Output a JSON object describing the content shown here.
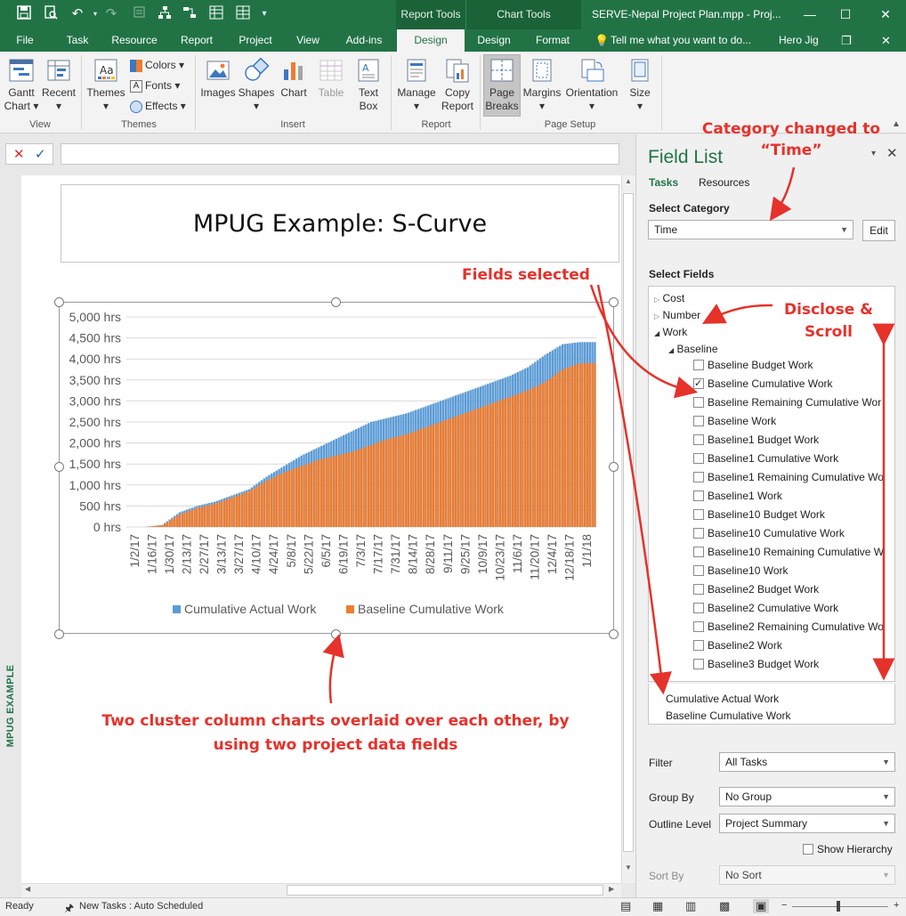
{
  "window": {
    "title": "SERVE-Nepal Project Plan.mpp - Proj...",
    "context_tabs": [
      "Report Tools",
      "Chart Tools"
    ],
    "user": "Hero Jig",
    "tell_me": "Tell me what you want to do..."
  },
  "tabs": [
    "File",
    "Task",
    "Resource",
    "Report",
    "Project",
    "View",
    "Add-ins",
    "Design",
    "Design",
    "Format"
  ],
  "ribbon": {
    "view": {
      "gantt_chart": "Gantt",
      "gantt_chart2": "Chart",
      "recent": "Recent",
      "label": "View"
    },
    "themes": {
      "themes": "Themes",
      "colors": "Colors",
      "fonts": "Fonts",
      "effects": "Effects",
      "label": "Themes"
    },
    "insert": {
      "images": "Images",
      "shapes": "Shapes",
      "chart": "Chart",
      "table": "Table",
      "textbox1": "Text",
      "textbox2": "Box",
      "label": "Insert"
    },
    "report": {
      "manage": "Manage",
      "copy1": "Copy",
      "copy2": "Report",
      "label": "Report"
    },
    "page_setup": {
      "page1": "Page",
      "page2": "Breaks",
      "margins": "Margins",
      "orientation": "Orientation",
      "size": "Size",
      "label": "Page Setup"
    }
  },
  "report": {
    "title": "MPUG Example: S-Curve",
    "side_label": "MPUG EXAMPLE"
  },
  "chart_data": {
    "type": "bar",
    "title": "",
    "xlabel": "",
    "ylabel": "",
    "ylim": [
      0,
      5000
    ],
    "y_ticks": [
      "5,000 hrs",
      "4,500 hrs",
      "4,000 hrs",
      "3,500 hrs",
      "3,000 hrs",
      "2,500 hrs",
      "2,000 hrs",
      "1,500 hrs",
      "1,000 hrs",
      "500 hrs",
      "0 hrs"
    ],
    "x_ticks": [
      "1/2/17",
      "1/16/17",
      "1/30/17",
      "2/13/17",
      "2/27/17",
      "3/13/17",
      "3/27/17",
      "4/10/17",
      "4/24/17",
      "5/8/17",
      "5/22/17",
      "6/5/17",
      "6/19/17",
      "7/3/17",
      "7/17/17",
      "7/31/17",
      "8/14/17",
      "8/28/17",
      "9/11/17",
      "9/25/17",
      "10/9/17",
      "10/23/17",
      "11/6/17",
      "11/20/17",
      "12/4/17",
      "12/18/17",
      "1/1/18"
    ],
    "series": [
      {
        "name": "Cumulative Actual Work",
        "color": "#5b9bd5",
        "values": [
          0,
          0,
          50,
          350,
          500,
          600,
          750,
          900,
          1200,
          1450,
          1700,
          1900,
          2100,
          2300,
          2500,
          2600,
          2700,
          2850,
          3000,
          3150,
          3300,
          3450,
          3600,
          3800,
          4100,
          4350,
          4400
        ]
      },
      {
        "name": "Baseline Cumulative Work",
        "color": "#ed7d31",
        "values": [
          0,
          0,
          40,
          300,
          450,
          550,
          700,
          850,
          1100,
          1300,
          1450,
          1600,
          1700,
          1800,
          1950,
          2100,
          2200,
          2350,
          2500,
          2650,
          2800,
          2950,
          3100,
          3250,
          3450,
          3750,
          3900
        ]
      }
    ],
    "legend": "bottom"
  },
  "annotations": {
    "category": [
      "Category changed to",
      "“Time”"
    ],
    "fields": "Fields selected",
    "disclose": [
      "Disclose &",
      "Scroll"
    ],
    "overlay": [
      "Two cluster column charts overlaid over each other, by",
      "using two project data fields"
    ]
  },
  "field_list": {
    "title": "Field List",
    "tabs": [
      "Tasks",
      "Resources"
    ],
    "select_category_label": "Select Category",
    "category_value": "Time",
    "edit_label": "Edit",
    "select_fields_label": "Select Fields",
    "tree_groups": [
      "Cost",
      "Number",
      "Work",
      "Baseline"
    ],
    "fields": [
      {
        "name": "Baseline Budget Work",
        "checked": false
      },
      {
        "name": "Baseline Cumulative Work",
        "checked": true
      },
      {
        "name": "Baseline Remaining Cumulative Wor",
        "checked": false
      },
      {
        "name": "Baseline Work",
        "checked": false
      },
      {
        "name": "Baseline1 Budget Work",
        "checked": false
      },
      {
        "name": "Baseline1 Cumulative Work",
        "checked": false
      },
      {
        "name": "Baseline1 Remaining Cumulative Wo",
        "checked": false
      },
      {
        "name": "Baseline1 Work",
        "checked": false
      },
      {
        "name": "Baseline10 Budget Work",
        "checked": false
      },
      {
        "name": "Baseline10 Cumulative Work",
        "checked": false
      },
      {
        "name": "Baseline10 Remaining Cumulative W",
        "checked": false
      },
      {
        "name": "Baseline10 Work",
        "checked": false
      },
      {
        "name": "Baseline2 Budget Work",
        "checked": false
      },
      {
        "name": "Baseline2 Cumulative Work",
        "checked": false
      },
      {
        "name": "Baseline2 Remaining Cumulative Wo",
        "checked": false
      },
      {
        "name": "Baseline2 Work",
        "checked": false
      },
      {
        "name": "Baseline3 Budget Work",
        "checked": false
      }
    ],
    "selected_fields": [
      "Cumulative Actual Work",
      "Baseline Cumulative Work"
    ],
    "filter_label": "Filter",
    "filter_value": "All Tasks",
    "group_label": "Group By",
    "group_value": "No Group",
    "outline_label": "Outline Level",
    "outline_value": "Project Summary",
    "show_hierarchy": "Show Hierarchy",
    "sort_label": "Sort By",
    "sort_value": "No Sort"
  },
  "status": {
    "ready": "Ready",
    "new_tasks": "New Tasks : Auto Scheduled"
  },
  "colors": {
    "accent": "#217346",
    "annotation": "#e5322b",
    "actual": "#5b9bd5",
    "baseline": "#ed7d31"
  }
}
